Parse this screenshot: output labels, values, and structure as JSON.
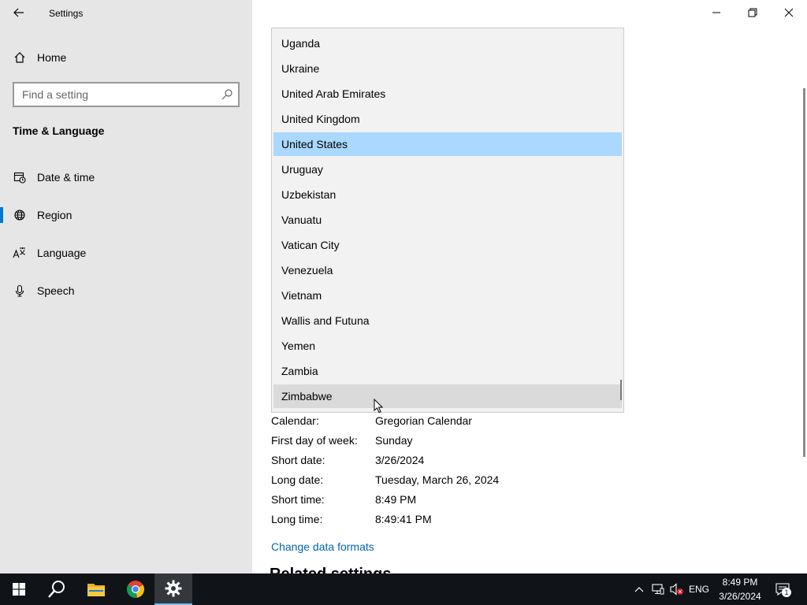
{
  "window": {
    "title": "Settings"
  },
  "sidebar": {
    "home_label": "Home",
    "search_placeholder": "Find a setting",
    "section_title": "Time & Language",
    "items": [
      {
        "label": "Date & time",
        "icon": "calendar-clock-icon"
      },
      {
        "label": "Region",
        "icon": "globe-icon",
        "active": true
      },
      {
        "label": "Language",
        "icon": "language-icon"
      },
      {
        "label": "Speech",
        "icon": "microphone-icon"
      }
    ]
  },
  "dropdown": {
    "options": [
      "Uganda",
      "Ukraine",
      "United Arab Emirates",
      "United Kingdom",
      "United States",
      "Uruguay",
      "Uzbekistan",
      "Vanuatu",
      "Vatican City",
      "Venezuela",
      "Vietnam",
      "Wallis and Futuna",
      "Yemen",
      "Zambia",
      "Zimbabwe"
    ],
    "selected": "United States",
    "hovered": "Zimbabwe"
  },
  "formats": [
    {
      "key": "Calendar:",
      "value": "Gregorian Calendar"
    },
    {
      "key": "First day of week:",
      "value": "Sunday"
    },
    {
      "key": "Short date:",
      "value": "3/26/2024"
    },
    {
      "key": "Long date:",
      "value": "Tuesday, March 26, 2024"
    },
    {
      "key": "Short time:",
      "value": "8:49 PM"
    },
    {
      "key": "Long time:",
      "value": "8:49:41 PM"
    }
  ],
  "change_formats_link": "Change data formats",
  "related_heading": "Related settings",
  "taskbar": {
    "language": "ENG",
    "time": "8:49 PM",
    "date": "3/26/2024",
    "notification_count": "1"
  },
  "colors": {
    "accent": "#0078d7",
    "selected_bg": "#aad8ff",
    "hover_bg": "#dadada",
    "link": "#0066b4",
    "taskbar": "#101418"
  }
}
